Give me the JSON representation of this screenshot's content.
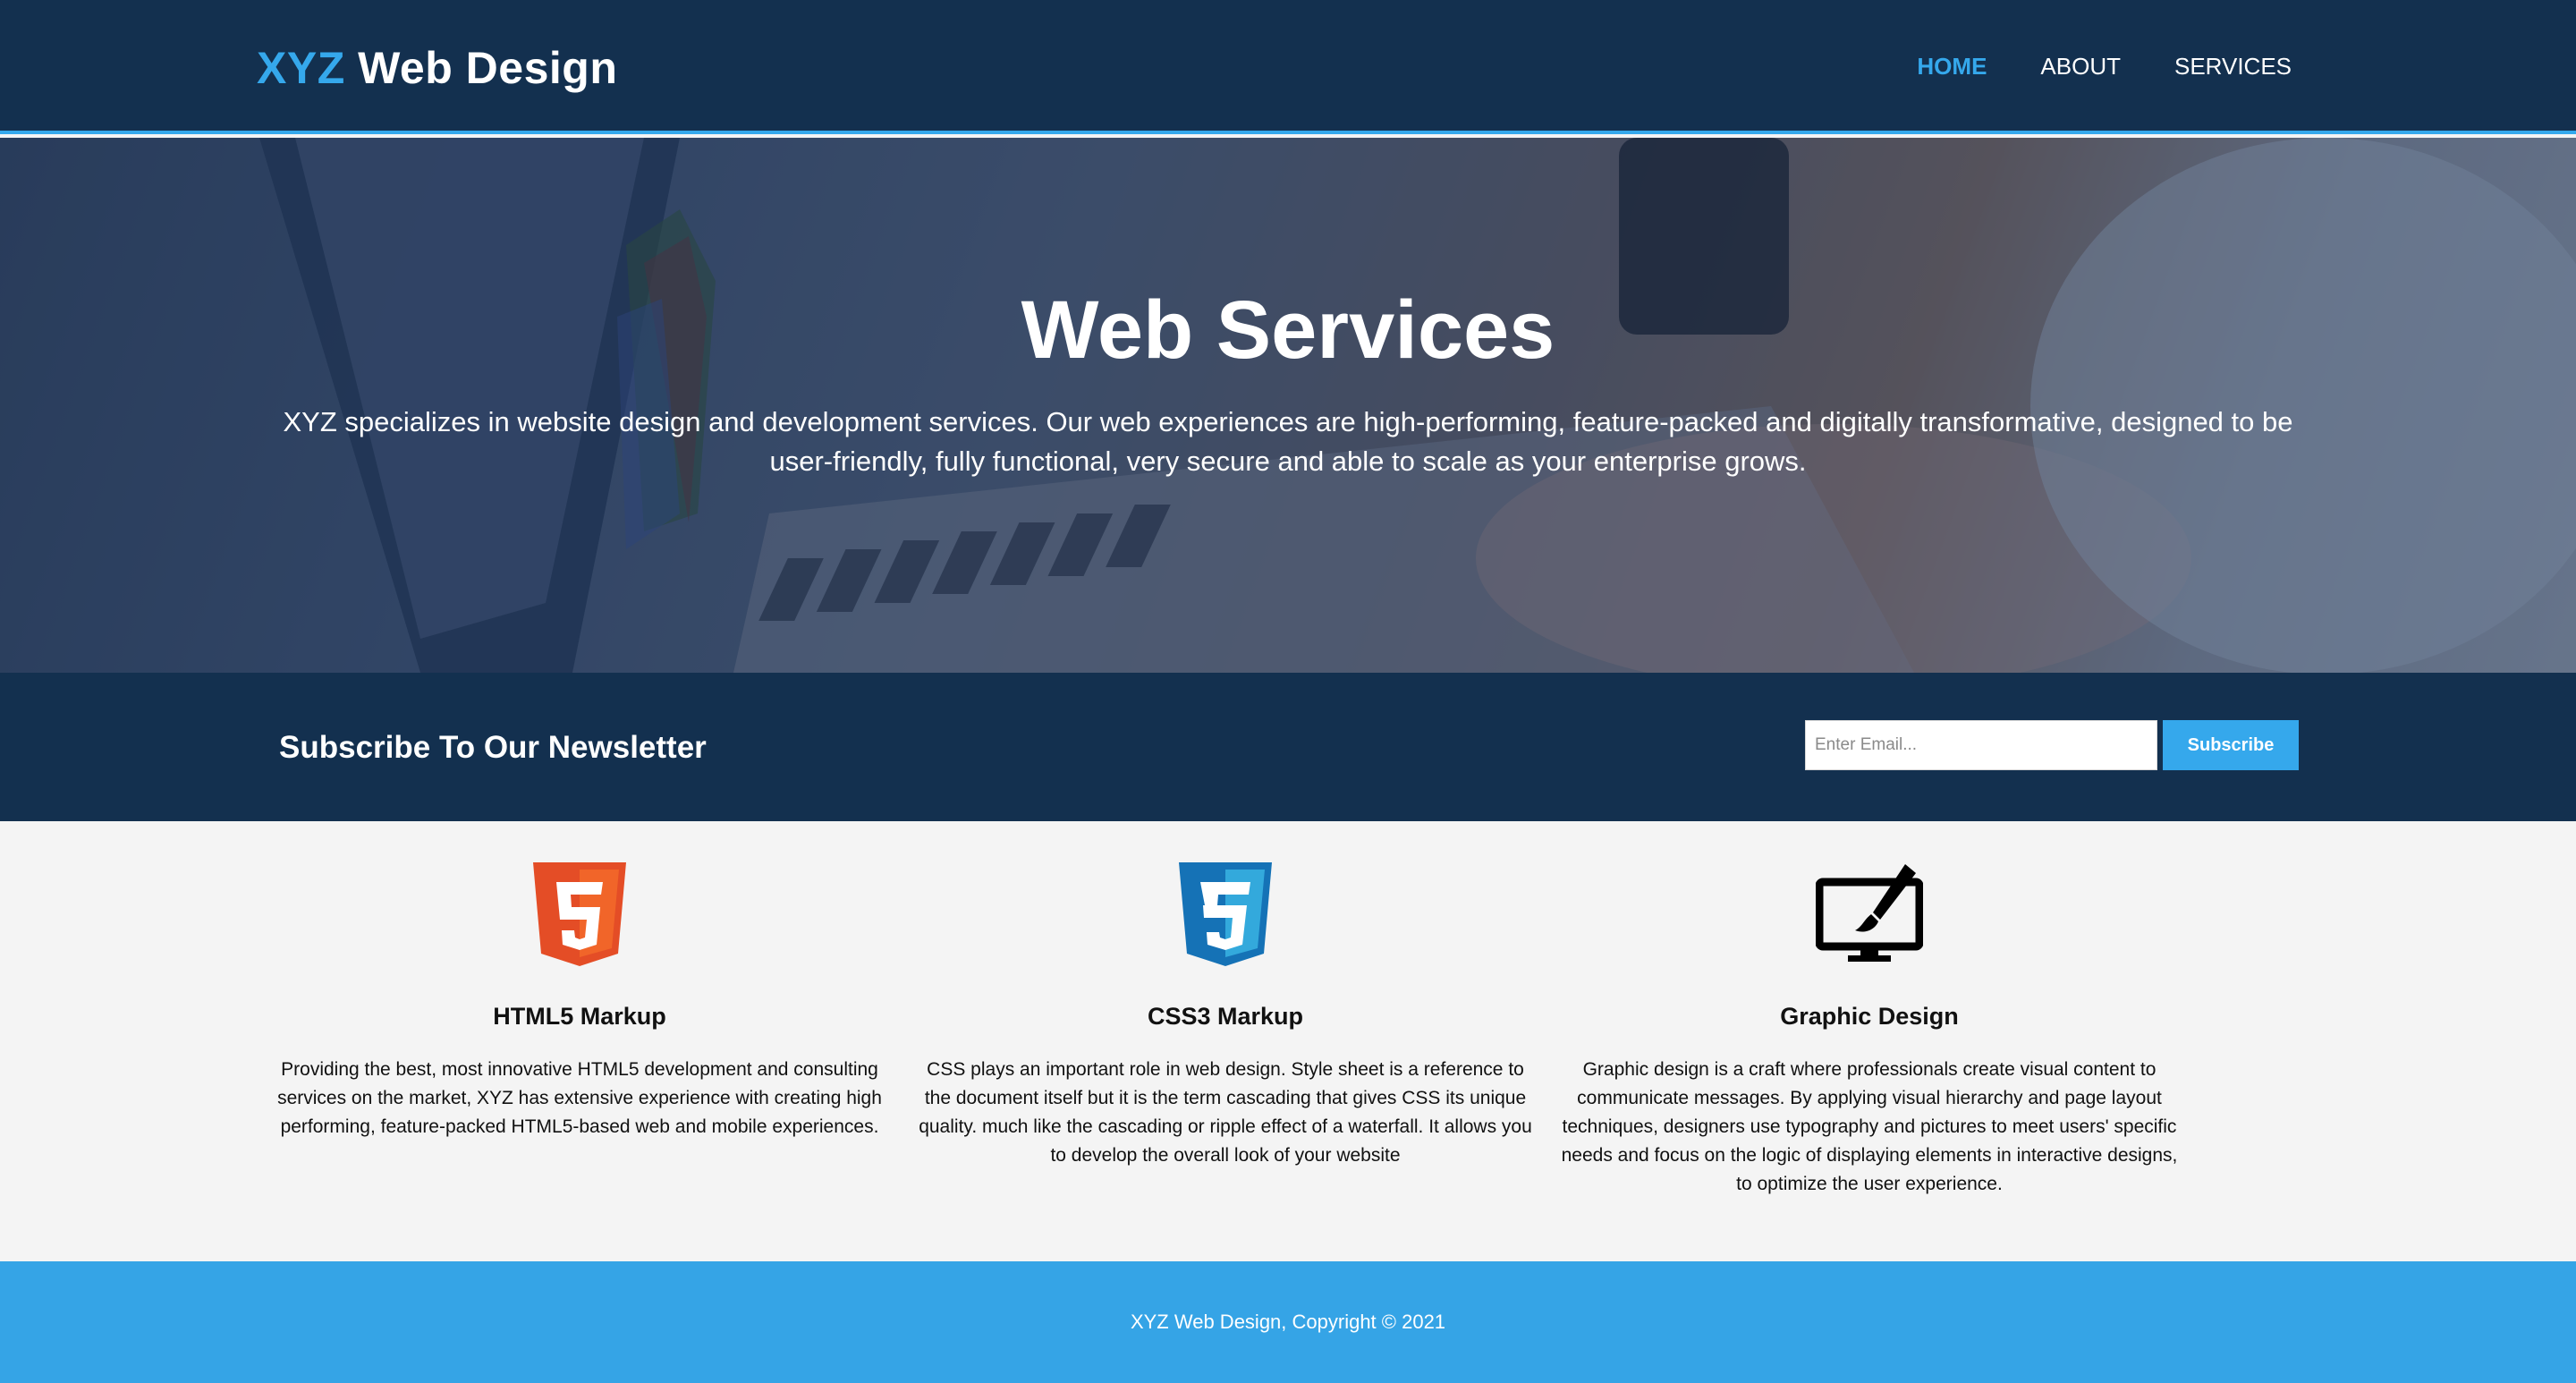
{
  "header": {
    "logo_accent": "XYZ",
    "logo_rest": " Web Design",
    "nav": [
      {
        "label": "Home"
      },
      {
        "label": "About"
      },
      {
        "label": "Services"
      }
    ]
  },
  "hero": {
    "title": "Web Services",
    "text": "XYZ specializes in website design and development services. Our web experiences are high-performing, feature-packed and digitally transformative, designed to be user-friendly, fully functional, very secure and able to scale as your enterprise grows."
  },
  "newsletter": {
    "title": "Subscribe To Our Newsletter",
    "placeholder": "Enter Email...",
    "button": "Subscribe"
  },
  "features": [
    {
      "icon": "html5-icon",
      "title": "HTML5 Markup",
      "text": "Providing the best, most innovative HTML5 development and consulting services on the market, XYZ has extensive experience with creating high performing, feature-packed HTML5-based web and mobile experiences."
    },
    {
      "icon": "css3-icon",
      "title": "CSS3 Markup",
      "text": "CSS plays an important role in web design. Style sheet is a reference to the document itself but it is the term cascading that gives CSS its unique quality. much like the cascading or ripple effect of a waterfall. It allows you to develop the overall look of your website"
    },
    {
      "icon": "graphic-design-monitor-icon",
      "title": "Graphic Design",
      "text": "Graphic design is a craft where professionals create visual content to communicate messages. By applying visual hierarchy and page layout techniques, designers use typography and pictures to meet users' specific needs and focus on the logic of displaying elements in interactive designs, to optimize the user experience."
    }
  ],
  "footer": {
    "copyright": "XYZ Web Design, Copyright © 2021"
  },
  "colors": {
    "navy": "#13304f",
    "accent": "#35a8ec",
    "footer": "#35a4e6",
    "background": "#f4f4f4"
  }
}
